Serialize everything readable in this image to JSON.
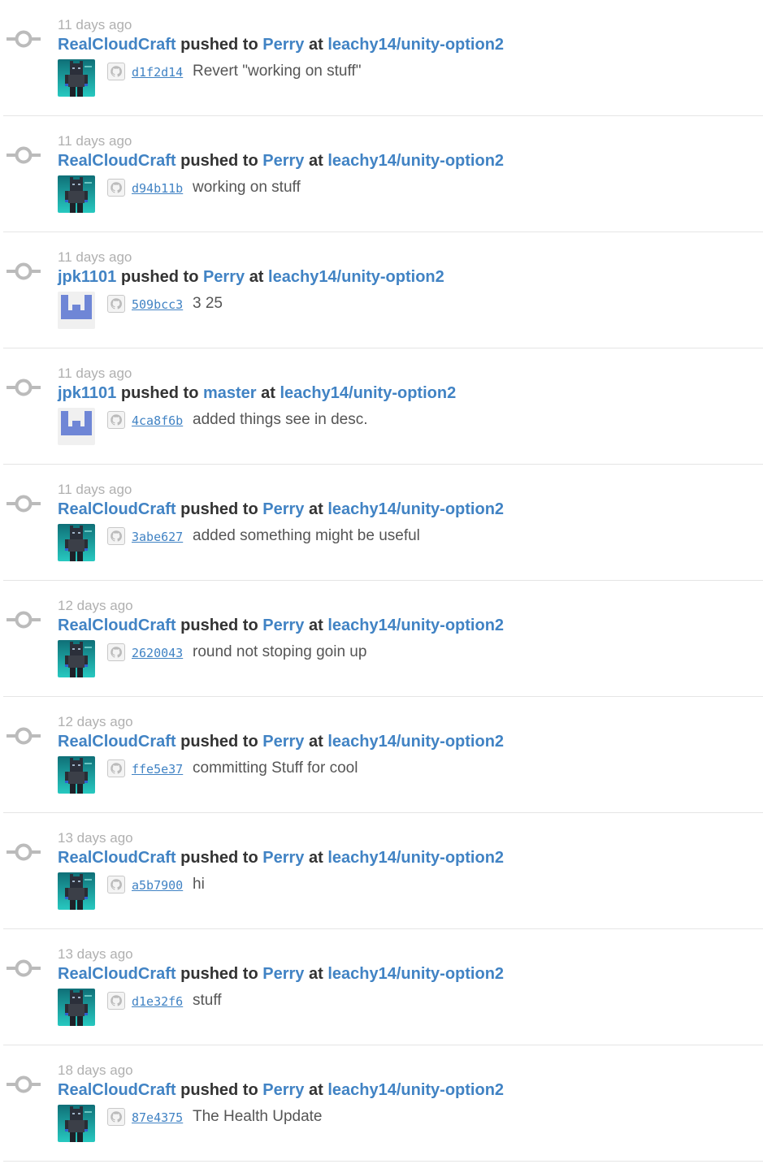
{
  "events": [
    {
      "time": "11 days ago",
      "actor": "RealCloudCraft",
      "action": "pushed to",
      "branch": "Perry",
      "at": "at",
      "repo": "leachy14/unity-option2",
      "avatar": "cat-skin",
      "sha": "d1f2d14",
      "message": "Revert \"working on stuff\""
    },
    {
      "time": "11 days ago",
      "actor": "RealCloudCraft",
      "action": "pushed to",
      "branch": "Perry",
      "at": "at",
      "repo": "leachy14/unity-option2",
      "avatar": "cat-skin",
      "sha": "d94b11b",
      "message": "working on stuff"
    },
    {
      "time": "11 days ago",
      "actor": "jpk1101",
      "action": "pushed to",
      "branch": "Perry",
      "at": "at",
      "repo": "leachy14/unity-option2",
      "avatar": "identicon",
      "sha": "509bcc3",
      "message": "3 25"
    },
    {
      "time": "11 days ago",
      "actor": "jpk1101",
      "action": "pushed to",
      "branch": "master",
      "at": "at",
      "repo": "leachy14/unity-option2",
      "avatar": "identicon",
      "sha": "4ca8f6b",
      "message": "added things see in desc."
    },
    {
      "time": "11 days ago",
      "actor": "RealCloudCraft",
      "action": "pushed to",
      "branch": "Perry",
      "at": "at",
      "repo": "leachy14/unity-option2",
      "avatar": "cat-skin",
      "sha": "3abe627",
      "message": "added something might be useful"
    },
    {
      "time": "12 days ago",
      "actor": "RealCloudCraft",
      "action": "pushed to",
      "branch": "Perry",
      "at": "at",
      "repo": "leachy14/unity-option2",
      "avatar": "cat-skin",
      "sha": "2620043",
      "message": "round not stoping goin up"
    },
    {
      "time": "12 days ago",
      "actor": "RealCloudCraft",
      "action": "pushed to",
      "branch": "Perry",
      "at": "at",
      "repo": "leachy14/unity-option2",
      "avatar": "cat-skin",
      "sha": "ffe5e37",
      "message": "committing Stuff for cool"
    },
    {
      "time": "13 days ago",
      "actor": "RealCloudCraft",
      "action": "pushed to",
      "branch": "Perry",
      "at": "at",
      "repo": "leachy14/unity-option2",
      "avatar": "cat-skin",
      "sha": "a5b7900",
      "message": "hi"
    },
    {
      "time": "13 days ago",
      "actor": "RealCloudCraft",
      "action": "pushed to",
      "branch": "Perry",
      "at": "at",
      "repo": "leachy14/unity-option2",
      "avatar": "cat-skin",
      "sha": "d1e32f6",
      "message": "stuff"
    },
    {
      "time": "18 days ago",
      "actor": "RealCloudCraft",
      "action": "pushed to",
      "branch": "Perry",
      "at": "at",
      "repo": "leachy14/unity-option2",
      "avatar": "cat-skin",
      "sha": "87e4375",
      "message": "The Health Update"
    }
  ],
  "colors": {
    "link": "#4183c4",
    "muted": "#b0b0b0",
    "text": "#333333",
    "icon": "#bbbbbb",
    "identicon": "#6f86d6",
    "skin_bg": "#1fb6b0"
  }
}
